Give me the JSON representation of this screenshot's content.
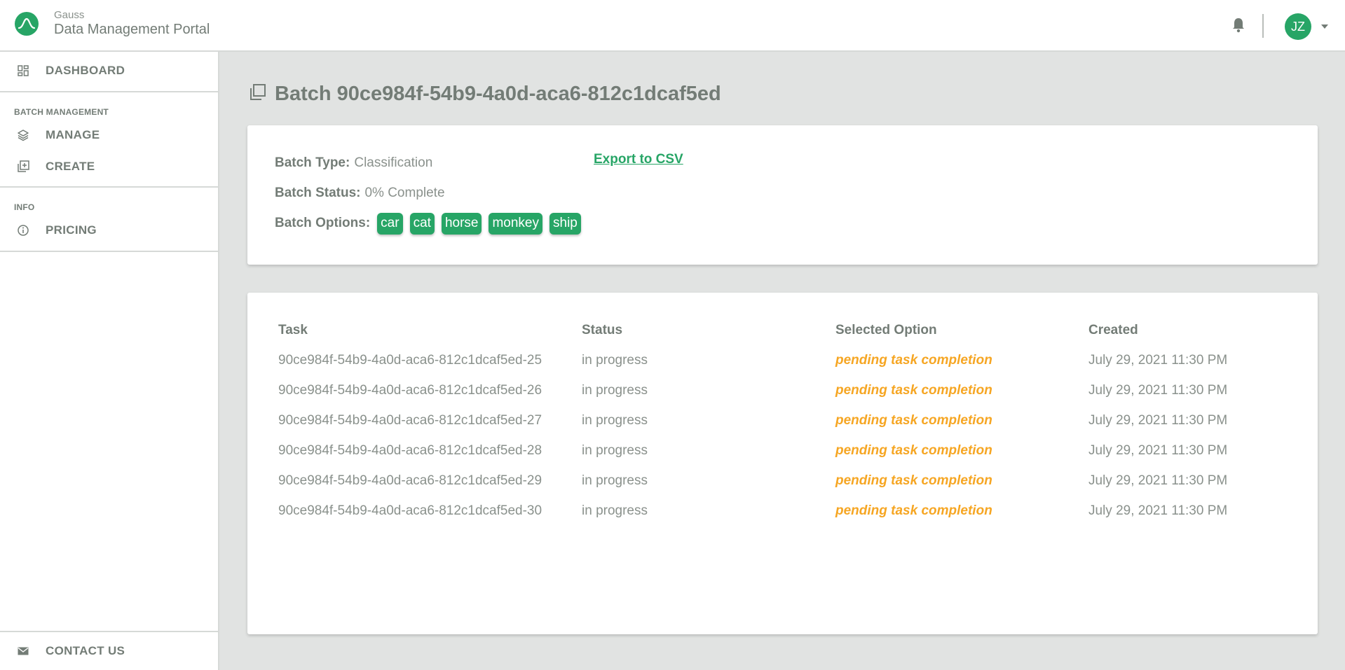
{
  "header": {
    "brand_small": "Gauss",
    "brand_title": "Data Management Portal",
    "avatar_initials": "JZ"
  },
  "sidebar": {
    "dashboard": "DASHBOARD",
    "section_batch": "BATCH MANAGEMENT",
    "manage": "MANAGE",
    "create": "CREATE",
    "section_info": "INFO",
    "pricing": "PRICING",
    "contact": "CONTACT US"
  },
  "page": {
    "title": "Batch 90ce984f-54b9-4a0d-aca6-812c1dcaf5ed"
  },
  "batch": {
    "type_label": "Batch Type:",
    "type_value": "Classification",
    "status_label": "Batch Status:",
    "status_value": "0% Complete",
    "options_label": "Batch Options:",
    "options": [
      "car",
      "cat",
      "horse",
      "monkey",
      "ship"
    ],
    "export_label": "Export to CSV"
  },
  "table": {
    "headers": [
      "Task",
      "Status",
      "Selected Option",
      "Created"
    ],
    "rows": [
      {
        "task": "90ce984f-54b9-4a0d-aca6-812c1dcaf5ed-25",
        "status": "in progress",
        "option": "pending task completion",
        "created": "July 29, 2021 11:30 PM"
      },
      {
        "task": "90ce984f-54b9-4a0d-aca6-812c1dcaf5ed-26",
        "status": "in progress",
        "option": "pending task completion",
        "created": "July 29, 2021 11:30 PM"
      },
      {
        "task": "90ce984f-54b9-4a0d-aca6-812c1dcaf5ed-27",
        "status": "in progress",
        "option": "pending task completion",
        "created": "July 29, 2021 11:30 PM"
      },
      {
        "task": "90ce984f-54b9-4a0d-aca6-812c1dcaf5ed-28",
        "status": "in progress",
        "option": "pending task completion",
        "created": "July 29, 2021 11:30 PM"
      },
      {
        "task": "90ce984f-54b9-4a0d-aca6-812c1dcaf5ed-29",
        "status": "in progress",
        "option": "pending task completion",
        "created": "July 29, 2021 11:30 PM"
      },
      {
        "task": "90ce984f-54b9-4a0d-aca6-812c1dcaf5ed-30",
        "status": "in progress",
        "option": "pending task completion",
        "created": "July 29, 2021 11:30 PM"
      }
    ]
  },
  "colors": {
    "accent": "#27a566",
    "pending": "#f6a623",
    "text": "#737c76",
    "background": "#e1e3e2"
  },
  "icons": {
    "logo": "gauss-curve-icon",
    "notifications": "bell-icon",
    "avatar_menu": "caret-down-icon",
    "dashboard": "dashboard-icon",
    "manage": "layers-icon",
    "create": "add-box-icon",
    "pricing": "info-icon",
    "contact": "mail-icon",
    "title": "copy-icon"
  }
}
